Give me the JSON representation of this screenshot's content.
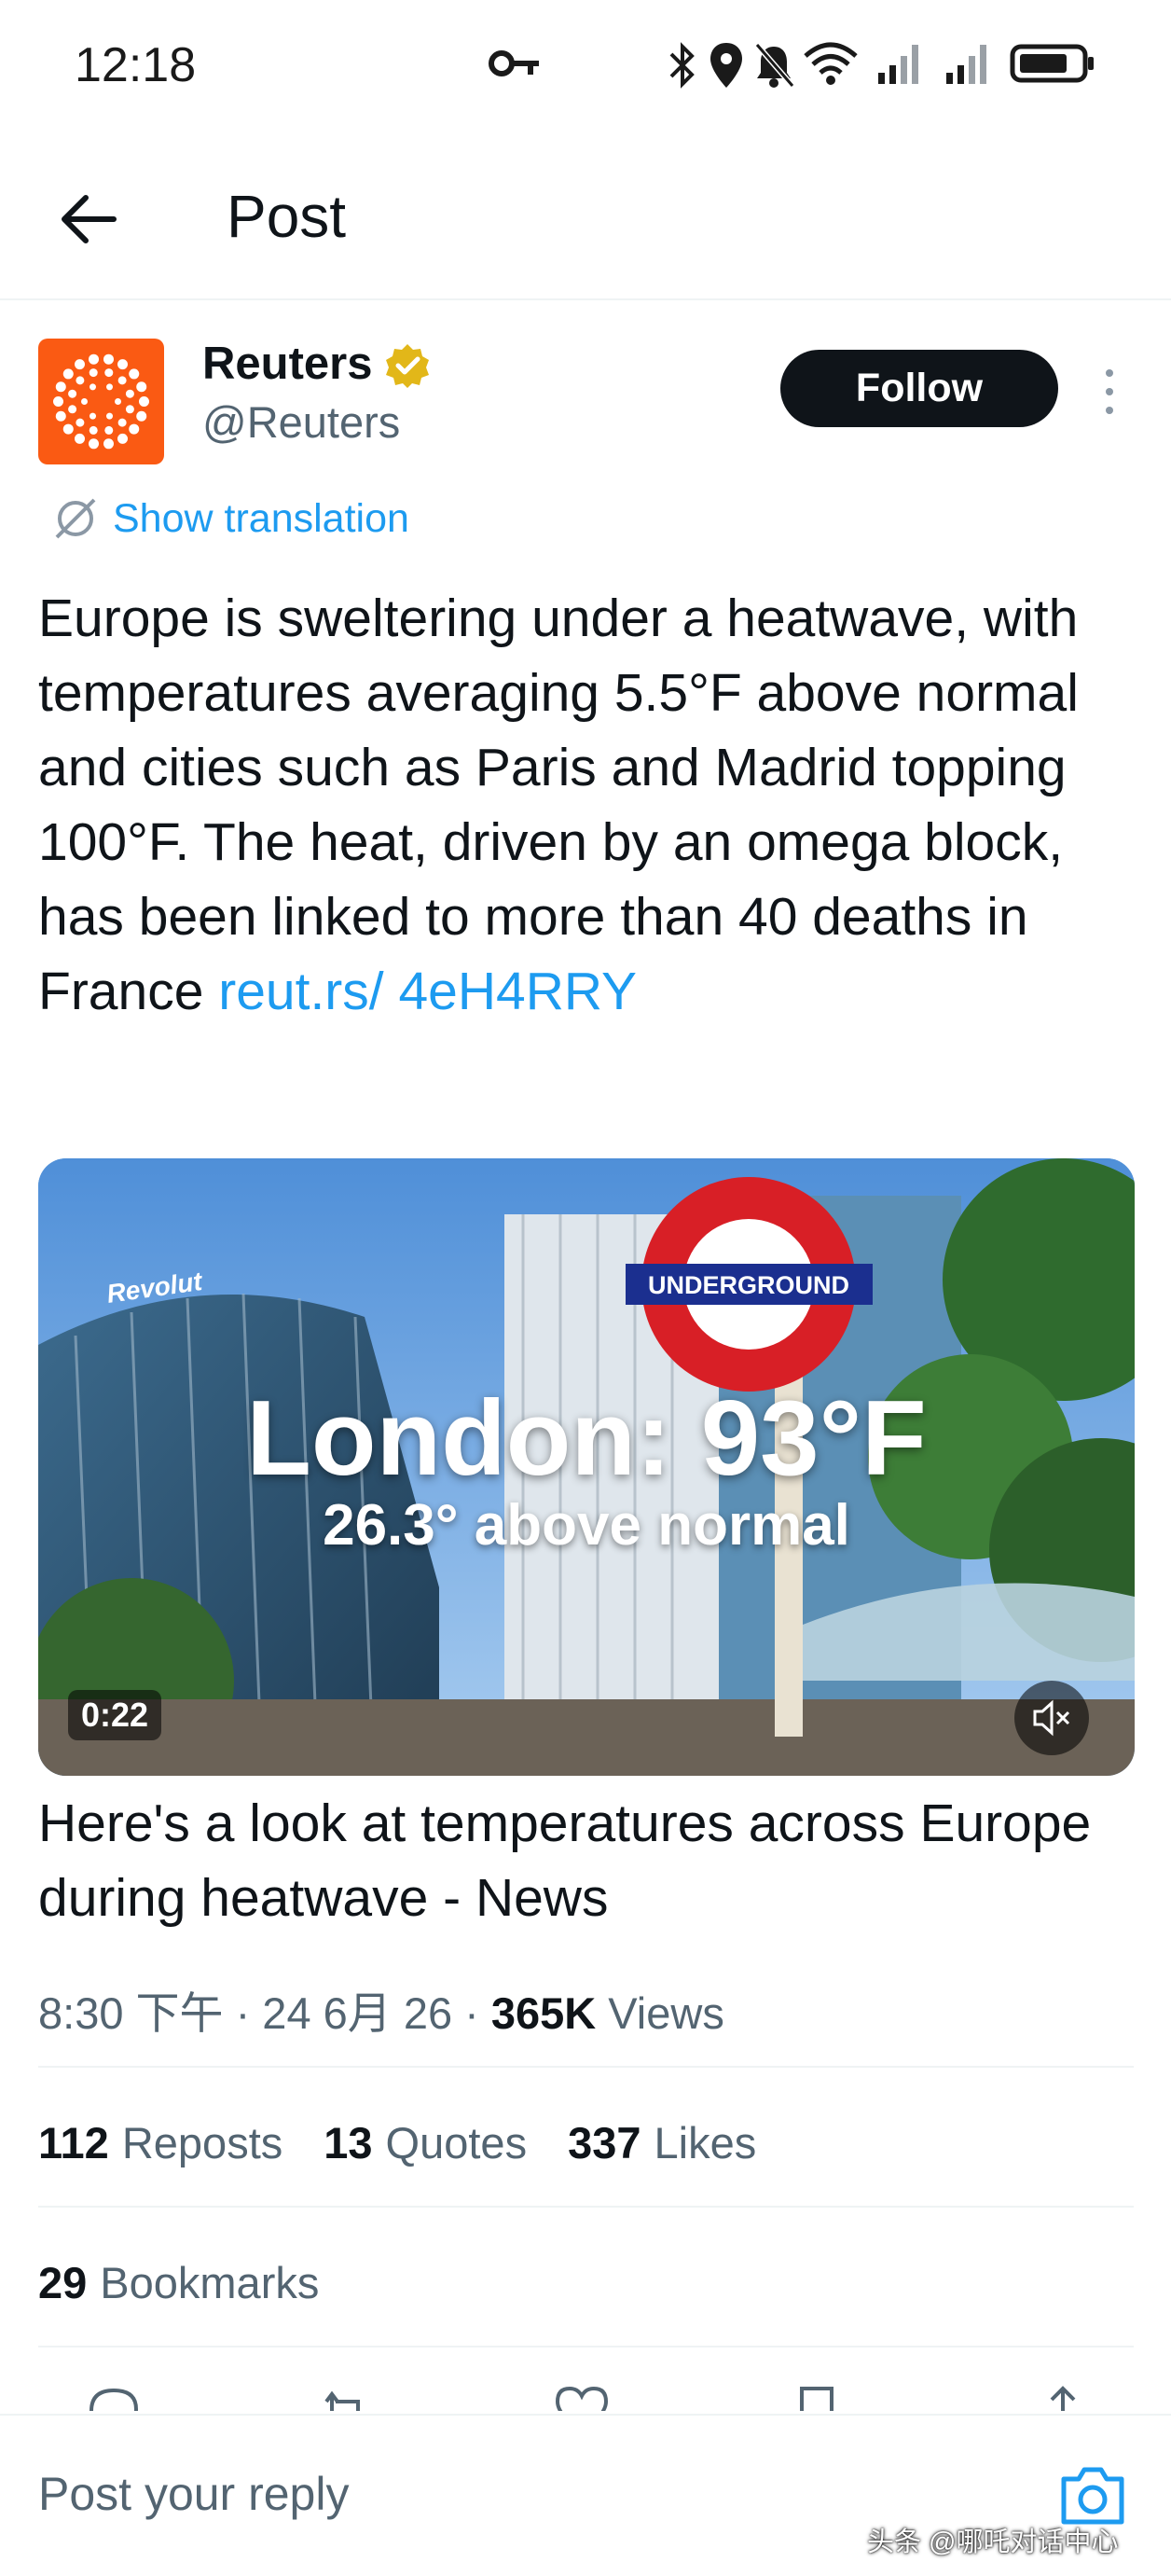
{
  "status_bar": {
    "time": "12:18",
    "icons": [
      "key-icon",
      "bluetooth-icon",
      "location-icon",
      "bell-off-icon",
      "wifi-icon",
      "signal-icon",
      "signal-icon",
      "battery-icon"
    ]
  },
  "header": {
    "title": "Post",
    "back_icon": "arrow-left-icon"
  },
  "tweet": {
    "author_name": "Reuters",
    "author_handle": "@Reuters",
    "verified_icon": "verified-badge-icon",
    "follow_label": "Follow",
    "translation_label": "Show translation",
    "text": "Europe is sweltering under a heatwave, with temperatures averaging 5.5°F above normal and cities such as Paris and Madrid topping 100°F. The heat, driven by an omega block, has been linked to more than 40 deaths in France ",
    "link": "reut.rs/ 4eH4RRY",
    "media": {
      "overlay_title": "London: 93°F",
      "overlay_subtitle": "26.3° above normal",
      "duration": "0:22",
      "sign_text": "UNDERGROUND",
      "building_text": "Revolut"
    },
    "media_caption": "Here's a look at temperatures across Europe during heatwave - News",
    "timestamp": "8:30 下午 · 24 6月 26 · ",
    "views_count": "365K",
    "views_label": " Views",
    "stats": {
      "reposts_count": "112",
      "reposts_label": "Reposts",
      "quotes_count": "13",
      "quotes_label": "Quotes",
      "likes_count": "337",
      "likes_label": "Likes",
      "bookmarks_count": "29",
      "bookmarks_label": "Bookmarks"
    }
  },
  "reply": {
    "placeholder": "Post your reply"
  },
  "watermark": "头条 @哪吒对话中心",
  "colors": {
    "accent": "#1d9bf0",
    "text": "#0f1419",
    "muted": "#536471",
    "avatar_bg": "#fa5a13",
    "verified": "#e2b719"
  }
}
